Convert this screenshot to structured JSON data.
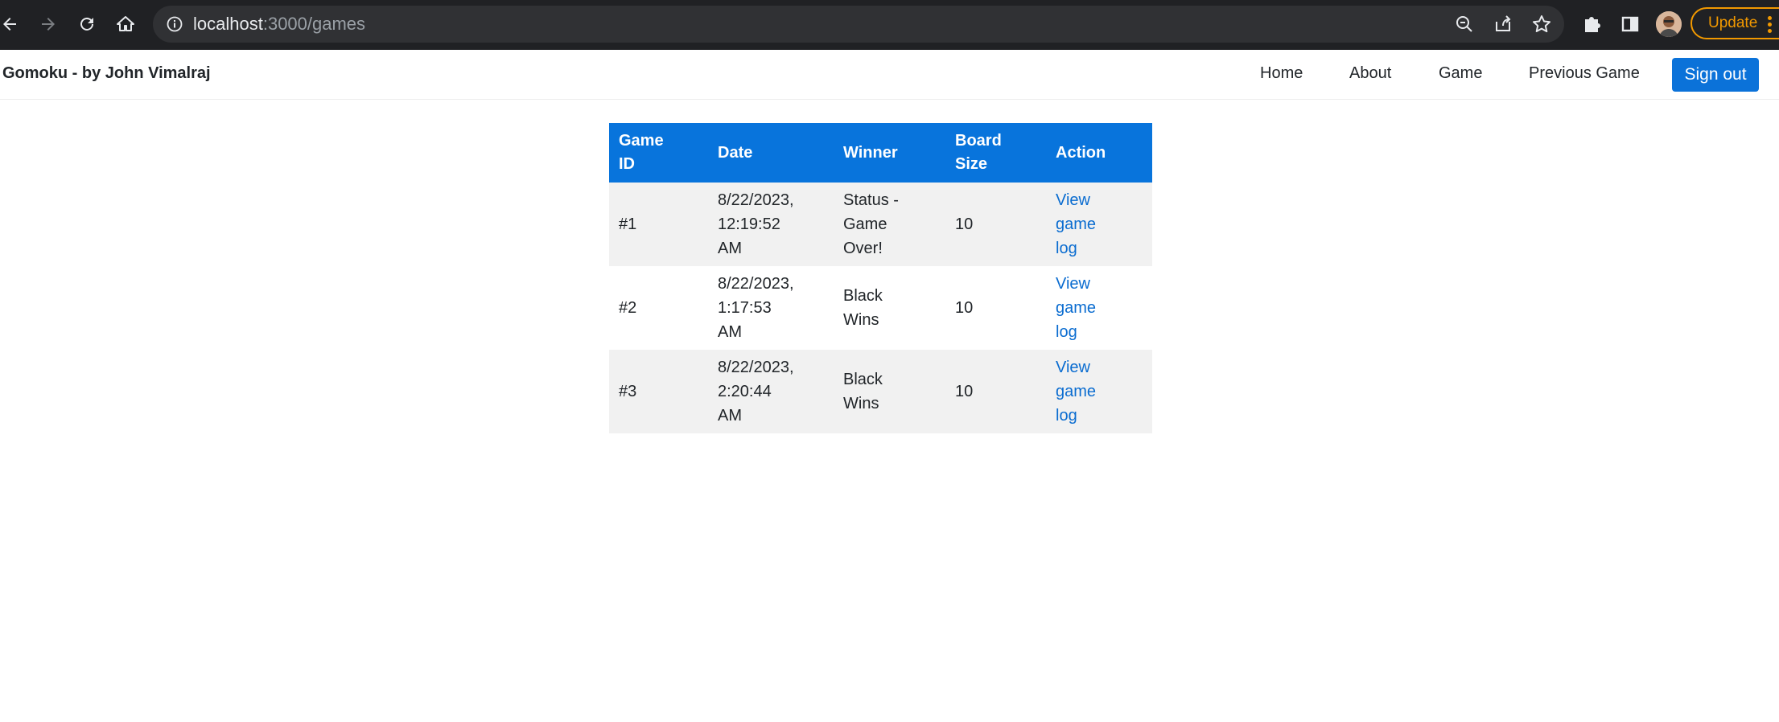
{
  "browser": {
    "url_host": "localhost",
    "url_rest": ":3000/games",
    "update_label": "Update",
    "accent_color": "#f29900"
  },
  "navbar": {
    "brand": "Gomoku - by John Vimalraj",
    "links": [
      "Home",
      "About",
      "Game",
      "Previous Game"
    ],
    "signout_label": "Sign out",
    "accent_color": "#0b72d9"
  },
  "table": {
    "headers": [
      [
        "Game",
        "ID"
      ],
      [
        "Date"
      ],
      [
        "Winner"
      ],
      [
        "Board",
        "Size"
      ],
      [
        "Action"
      ]
    ],
    "header_color": "#0874dc",
    "rows": [
      {
        "id": "#1",
        "date": [
          "8/22/2023,",
          "12:19:52",
          "AM"
        ],
        "winner": [
          "Status -",
          "Game",
          "Over!"
        ],
        "board_size": "10",
        "action": [
          "View",
          "game",
          "log"
        ]
      },
      {
        "id": "#2",
        "date": [
          "8/22/2023,",
          "1:17:53",
          "AM"
        ],
        "winner": [
          "Black",
          "Wins"
        ],
        "board_size": "10",
        "action": [
          "View",
          "game",
          "log"
        ]
      },
      {
        "id": "#3",
        "date": [
          "8/22/2023,",
          "2:20:44",
          "AM"
        ],
        "winner": [
          "Black",
          "Wins"
        ],
        "board_size": "10",
        "action": [
          "View",
          "game",
          "log"
        ]
      }
    ]
  }
}
